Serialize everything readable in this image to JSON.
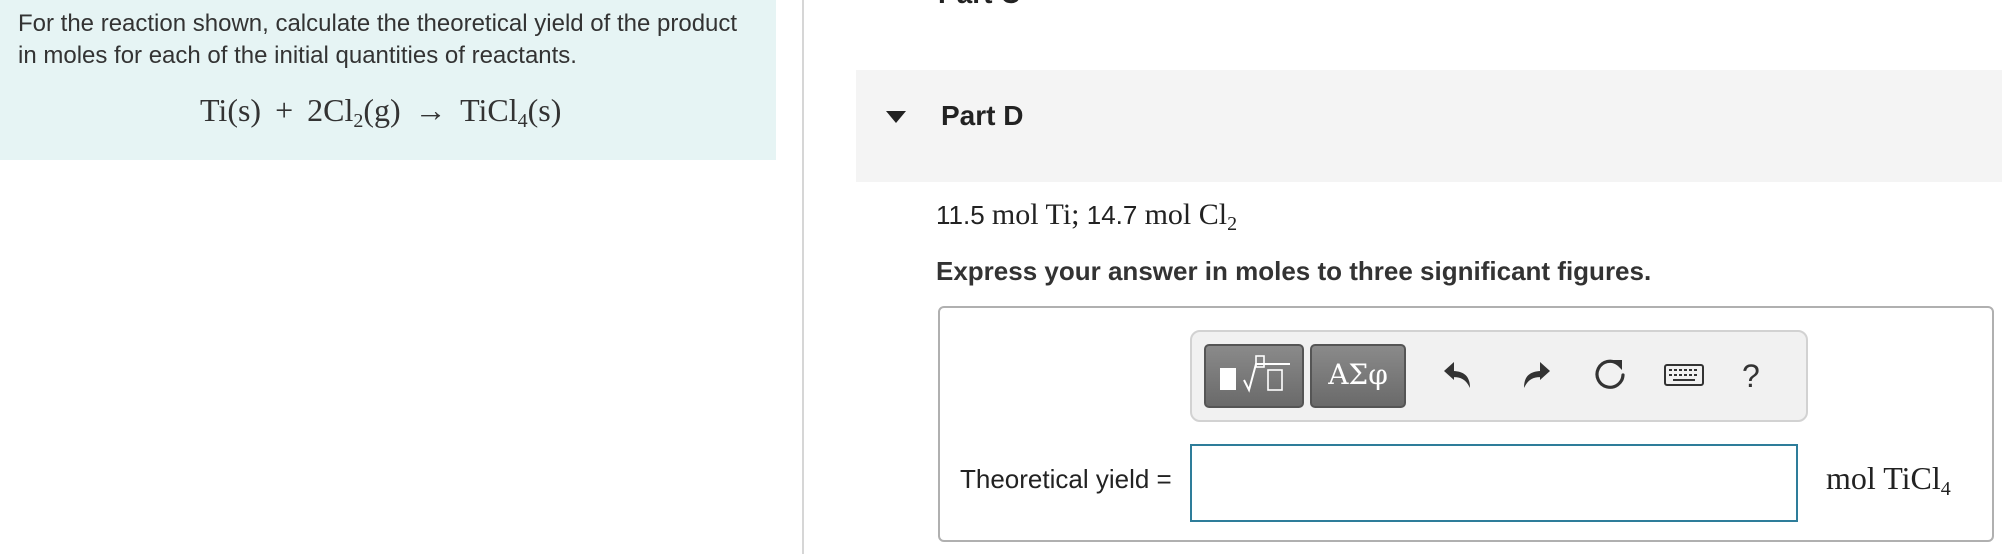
{
  "problem": {
    "prompt": "For the reaction shown, calculate the theoretical yield of the product in moles for each of the initial quantities of reactants.",
    "equation": {
      "ti": "Ti(s)",
      "plus": "+",
      "cl_coef": "2Cl",
      "cl_sub": "2",
      "cl_phase": "(g)",
      "arrow": "→",
      "prod": "TiCl",
      "prod_sub": "4",
      "prod_phase": "(s)"
    }
  },
  "part_c": {
    "title": "Part C"
  },
  "part_d": {
    "title": "Part D",
    "quantities": {
      "ti_amount": "11.5",
      "ti_unit": "mol Ti;",
      "cl_amount": "14.7",
      "cl_unit": "mol Cl",
      "cl_sub": "2"
    },
    "instruction": "Express your answer in moles to three significant figures.",
    "toolbar": {
      "greek_label": "ΑΣφ",
      "help_label": "?",
      "icons": [
        "templates-icon",
        "greek-letters-icon",
        "undo-icon",
        "redo-icon",
        "reset-icon",
        "keyboard-icon",
        "help-icon"
      ]
    },
    "answer": {
      "label": "Theoretical yield =",
      "value": "",
      "placeholder": "",
      "unit": "mol TiCl",
      "unit_sub": "4"
    }
  },
  "colors": {
    "problem_bg": "#e6f4f4",
    "part_header_bg": "#f4f4f4",
    "input_border": "#2e7d9a",
    "toolbar_dark_btn": "#777777"
  }
}
